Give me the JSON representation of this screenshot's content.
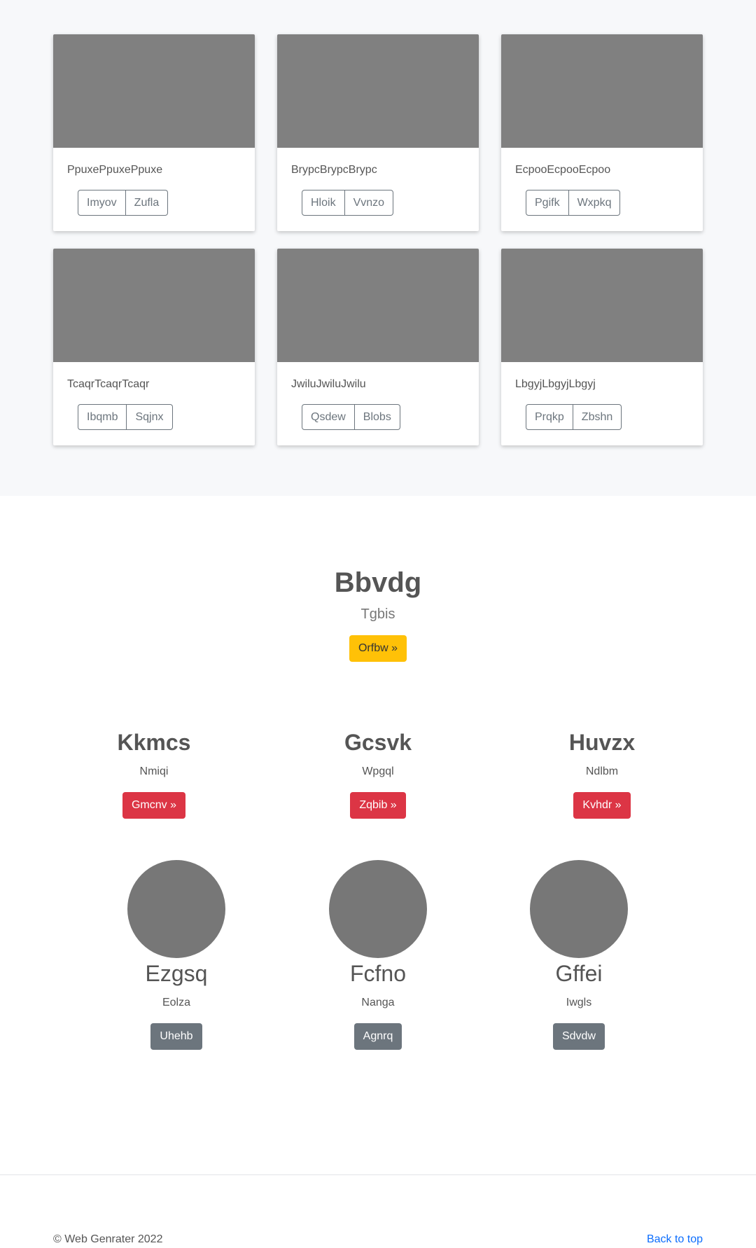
{
  "cards": [
    {
      "text": "PpuxePpuxePpuxe",
      "buttons": [
        "Imyov",
        "Zufla"
      ]
    },
    {
      "text": "BrypcBrypcBrypc",
      "buttons": [
        "Hloik",
        "Vvnzo"
      ]
    },
    {
      "text": "EcpooEcpooEcpoo",
      "buttons": [
        "Pgifk",
        "Wxpkq"
      ]
    },
    {
      "text": "TcaqrTcaqrTcaqr",
      "buttons": [
        "Ibqmb",
        "Sqjnx"
      ]
    },
    {
      "text": "JwiluJwiluJwilu",
      "buttons": [
        "Qsdew",
        "Blobs"
      ]
    },
    {
      "text": "LbgyjLbgyjLbgyj",
      "buttons": [
        "Prqkp",
        "Zbshn"
      ]
    }
  ],
  "hero": {
    "title": "Bbvdg",
    "subtitle": "Tgbis",
    "button": "Orfbw »"
  },
  "features": [
    {
      "title": "Kkmcs",
      "text": "Nmiqi",
      "button": "Gmcnv »"
    },
    {
      "title": "Gcsvk",
      "text": "Wpgql",
      "button": "Zqbib »"
    },
    {
      "title": "Huvzx",
      "text": "Ndlbm",
      "button": "Kvhdr »"
    }
  ],
  "team": [
    {
      "name": "Ezgsq",
      "text": "Eolza",
      "button": "Uhehb"
    },
    {
      "name": "Fcfno",
      "text": "Nanga",
      "button": "Agnrq"
    },
    {
      "name": "Gffei",
      "text": "Iwgls",
      "button": "Sdvdw"
    }
  ],
  "footer": {
    "copyright": "© Web Genrater 2022",
    "back_to_top": "Back to top"
  },
  "colors": {
    "warning": "#ffc107",
    "danger": "#dc3545",
    "secondary": "#6c757d",
    "link": "#0d6efd",
    "placeholder": "#808080"
  }
}
